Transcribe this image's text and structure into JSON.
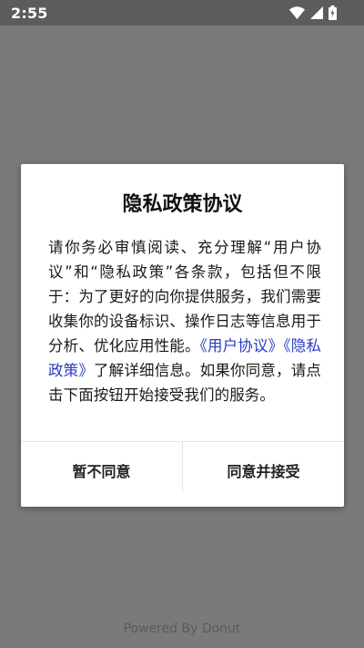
{
  "status_bar": {
    "time": "2:55",
    "icons": [
      "wifi-icon",
      "signal-icon",
      "battery-icon"
    ]
  },
  "dialog": {
    "title": "隐私政策协议",
    "body_before_links": "请你务必审慎阅读、充分理解“用户协议”和“隐私政策”各条款，包括但不限于：为了更好的向你提供服务，我们需要收集你的设备标识、操作日志等信息用于分析、优化应用性能。",
    "user_agreement_link": "《用户协议》",
    "privacy_policy_link": "《隐私政策》",
    "body_after_links": "了解详细信息。如果你同意，请点击下面按钮开始接受我们的服务。",
    "decline_label": "暂不同意",
    "accept_label": "同意并接受",
    "link_color": "#2a3bbf"
  },
  "footer": {
    "powered_by": "Powered By Donut"
  }
}
